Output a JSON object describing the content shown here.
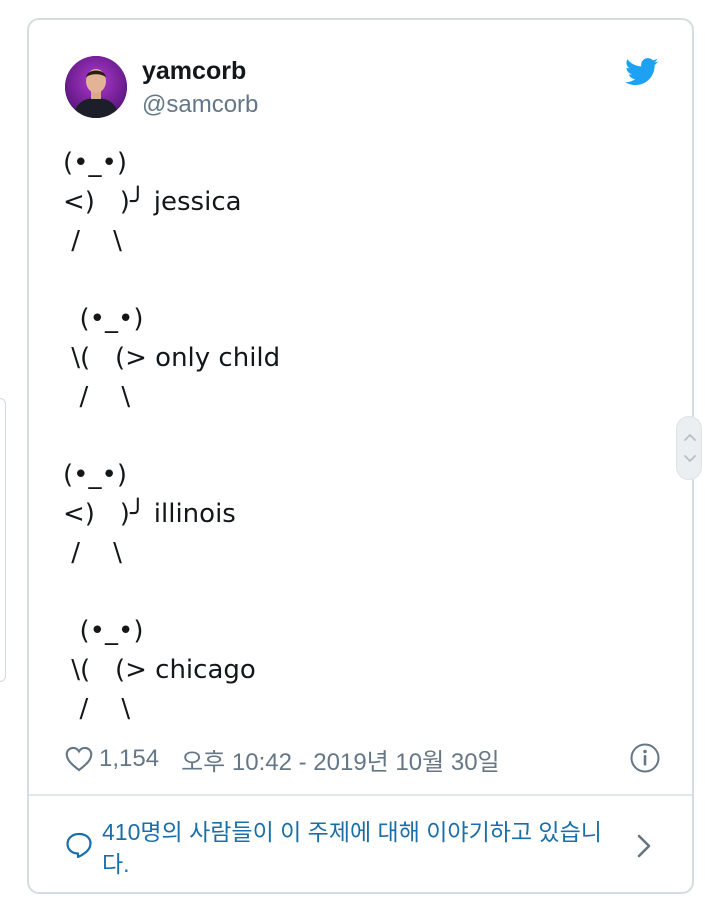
{
  "tweet": {
    "display_name": "yamcorb",
    "handle": "@samcorb",
    "text": "(•_•)\n<)   )╯ jessica\n /    \\\n\n  (•_•)\n \\(   (> only child\n  /    \\\n\n(•_•)\n<)   )╯ illinois\n /    \\\n\n  (•_•)\n \\(   (> chicago\n  /    \\",
    "likes": "1,154",
    "timestamp": "오후 10:42 - 2019년 10월 30일"
  },
  "conversation": {
    "text": "410명의 사람들이 이 주제에 대해 이야기하고 있습니다."
  },
  "icons": {
    "brand": "twitter-bird-icon",
    "like": "heart-icon",
    "info": "info-icon",
    "reply": "speech-bubble-icon",
    "next": "chevron-right-icon"
  },
  "colors": {
    "twitter_blue": "#1da1f2",
    "link_blue": "#1b6fa8",
    "secondary_text": "#657786",
    "border": "#d5dde2"
  }
}
